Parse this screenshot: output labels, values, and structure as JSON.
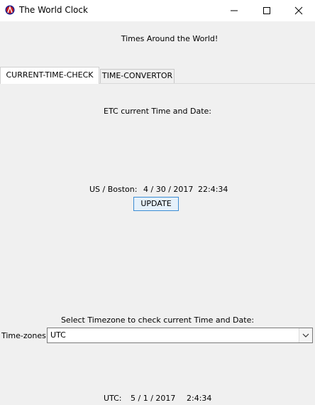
{
  "window": {
    "title": "The World Clock",
    "icon": "app-clock-icon"
  },
  "header": {
    "text": "Times Around the World!"
  },
  "tabs": [
    {
      "label": "CURRENT-TIME-CHECK",
      "active": true
    },
    {
      "label": "TIME-CONVERTOR",
      "active": false
    }
  ],
  "current_time": {
    "heading": "ETC current Time and Date:",
    "location_label": "US / Boston:",
    "date": "4 / 30 / 2017",
    "time": "22:4:34",
    "update_button": "UPDATE"
  },
  "timezone": {
    "heading": "Select Timezone to check current Time and Date:",
    "label": "Time-zones",
    "selected": "UTC",
    "result_label": "UTC:",
    "result_date": "5 / 1 / 2017",
    "result_time": "2:4:34"
  },
  "colors": {
    "background": "#f0f0f0",
    "titlebar": "#ffffff",
    "button_border": "#3c8dd3",
    "button_fill": "#e5f1fb"
  }
}
